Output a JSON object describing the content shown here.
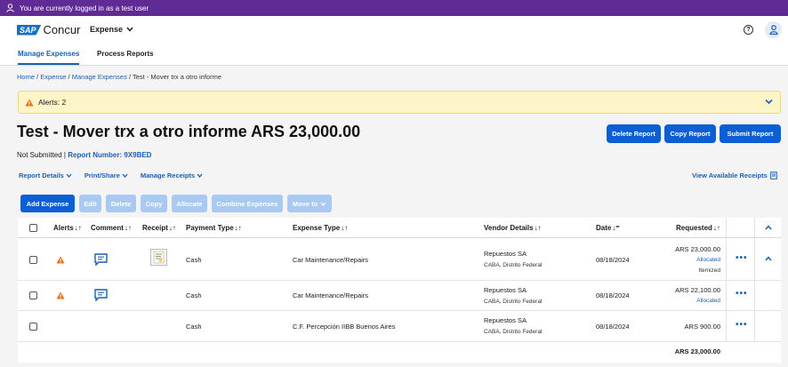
{
  "banner": {
    "text": "You are currently logged in as a test user"
  },
  "header": {
    "logo_sap": "SAP",
    "logo_product": "Concur",
    "app_menu": "Expense",
    "help_glyph": "?"
  },
  "nav": {
    "tabs": [
      {
        "label": "Manage Expenses",
        "active": true
      },
      {
        "label": "Process Reports",
        "active": false
      }
    ]
  },
  "breadcrumb": {
    "home": "Home",
    "sep1": " / ",
    "expense": "Expense",
    "sep2": " / ",
    "manage": "Manage Expenses",
    "current": " / Test - Mover trx a otro informe"
  },
  "alerts": {
    "label": "Alerts: 2"
  },
  "report": {
    "title": "Test - Mover trx a otro informe ARS 23,000.00",
    "status": "Not Submitted | ",
    "number_label": "Report Number: 9X9BED"
  },
  "actions": {
    "delete": "Delete Report",
    "copy": "Copy Report",
    "submit": "Submit Report"
  },
  "menus": {
    "details": "Report Details",
    "print": "Print/Share",
    "receipts": "Manage Receipts",
    "view_receipts": "View Available Receipts"
  },
  "toolbar": {
    "add": "Add Expense",
    "edit": "Edit",
    "delete": "Delete",
    "copy": "Copy",
    "allocate": "Allocate",
    "combine": "Combine Expenses",
    "move": "Move to"
  },
  "table": {
    "columns": {
      "alerts": "Alerts",
      "comment": "Comment",
      "receipt": "Receipt",
      "payment": "Payment Type",
      "expense": "Expense Type",
      "vendor": "Vendor Details",
      "date": "Date",
      "requested": "Requested"
    },
    "rows": [
      {
        "payment": "Cash",
        "expense": "Car Maintenance/Repairs",
        "vendor": "Repuestos SA",
        "location": "CABA, Distrito Federal",
        "date": "08/18/2024",
        "amount": "ARS 23,000.00",
        "allocated": "Allocated",
        "itemized": "Itemized"
      },
      {
        "payment": "Cash",
        "expense": "Car Maintenance/Repairs",
        "vendor": "Repuestos SA",
        "location": "CABA, Distrito Federal",
        "date": "08/18/2024",
        "amount": "ARS 22,100.00",
        "allocated": "Allocated"
      },
      {
        "payment": "Cash",
        "expense": "C.F. Percepción IIBB Buenos Aires",
        "vendor": "Repuestos SA",
        "location": "CABA, Distrito Federal",
        "date": "08/18/2024",
        "amount": "ARS 900.00"
      }
    ],
    "total": "ARS 23,000.00",
    "more_glyph": "•••"
  },
  "colors": {
    "accent": "#0a5fd4",
    "banner": "#5f2b95",
    "alert_bg": "#fdf4c8",
    "warning": "#e8741a"
  }
}
